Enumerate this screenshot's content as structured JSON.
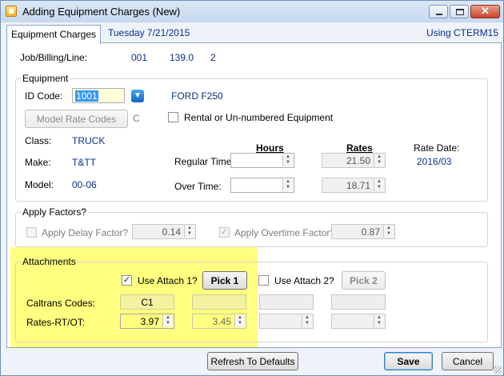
{
  "window": {
    "title": "Adding Equipment Charges  (New)",
    "close_glyph": "✕"
  },
  "tabstrip": {
    "tab_label": "Equipment Charges",
    "date": "Tuesday  7/21/2015",
    "using": "Using CTERM15"
  },
  "job": {
    "label": "Job/Billing/Line:",
    "job": "001",
    "billing": "139.0",
    "line": "2"
  },
  "equipment": {
    "group_title": "Equipment",
    "id_label": "ID Code:",
    "id_value": "1001",
    "description": "FORD F250",
    "model_rate_button": "Model Rate Codes",
    "rate_code": "C",
    "rental_label": "Rental or Un-numbered Equipment",
    "rental_checked": false,
    "class_label": "Class:",
    "class_value": "TRUCK",
    "make_label": "Make:",
    "make_value": "T&TT",
    "model_label": "Model:",
    "model_value": "00-06",
    "hours_header": "Hours",
    "rates_header": "Rates",
    "regular_label": "Regular Time:",
    "overtime_label": "Over Time:",
    "regular_hours": "",
    "overtime_hours": "",
    "regular_rate": "21.50",
    "overtime_rate": "18.71",
    "rate_date_label": "Rate Date:",
    "rate_date_value": "2016/03"
  },
  "factors": {
    "group_title": "Apply Factors?",
    "delay_label": "Apply Delay Factor?",
    "delay_checked": false,
    "delay_value": "0.14",
    "overtime_label": "Apply Overtime Factor?",
    "overtime_checked": true,
    "overtime_value": "0.87"
  },
  "attachments": {
    "group_title": "Attachments",
    "use1_label": "Use Attach 1?",
    "use1_checked": true,
    "pick1_label": "Pick 1",
    "use2_label": "Use Attach 2?",
    "use2_checked": false,
    "pick2_label": "Pick 2",
    "caltrans_label": "Caltrans Codes:",
    "rates_label": "Rates-RT/OT:",
    "attach1_caltrans": "C1",
    "attach1_rt": "3.97",
    "attach1_ot": "3.45"
  },
  "footer": {
    "refresh_label": "Refresh To Defaults",
    "save_label": "Save",
    "cancel_label": "Cancel"
  },
  "colors": {
    "highlight": "#ffff80",
    "label_blue": "#0a2f8c",
    "save_button_border": "#3c7fb1",
    "dropdown_button": "#1565c0"
  }
}
